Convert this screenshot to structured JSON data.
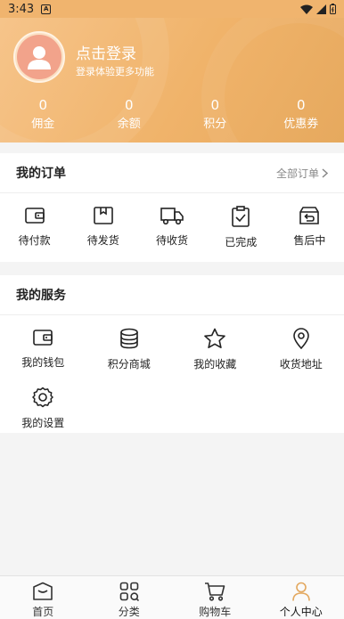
{
  "status_bar": {
    "time": "3:43"
  },
  "header": {
    "login_title": "点击登录",
    "login_subtitle": "登录体验更多功能",
    "stats": [
      {
        "value": "0",
        "label": "佣金"
      },
      {
        "value": "0",
        "label": "余额"
      },
      {
        "value": "0",
        "label": "积分"
      },
      {
        "value": "0",
        "label": "优惠券"
      }
    ]
  },
  "orders": {
    "title": "我的订单",
    "all_link": "全部订单",
    "items": [
      {
        "label": "待付款",
        "icon": "wallet-icon"
      },
      {
        "label": "待发货",
        "icon": "package-icon"
      },
      {
        "label": "待收货",
        "icon": "truck-icon"
      },
      {
        "label": "已完成",
        "icon": "clipboard-check-icon"
      },
      {
        "label": "售后中",
        "icon": "return-box-icon"
      }
    ]
  },
  "services": {
    "title": "我的服务",
    "items": [
      {
        "label": "我的钱包",
        "icon": "wallet-icon"
      },
      {
        "label": "积分商城",
        "icon": "coins-icon"
      },
      {
        "label": "我的收藏",
        "icon": "star-icon"
      },
      {
        "label": "收货地址",
        "icon": "location-pin-icon"
      },
      {
        "label": "我的设置",
        "icon": "gear-icon"
      }
    ]
  },
  "tabbar": {
    "tabs": [
      {
        "label": "首页",
        "icon": "home-icon"
      },
      {
        "label": "分类",
        "icon": "category-grid-icon"
      },
      {
        "label": "购物车",
        "icon": "cart-icon"
      },
      {
        "label": "个人中心",
        "icon": "person-icon",
        "active": true
      }
    ]
  },
  "colors": {
    "header_accent": "#f0b36a",
    "avatar_bg": "#f2a38b"
  }
}
